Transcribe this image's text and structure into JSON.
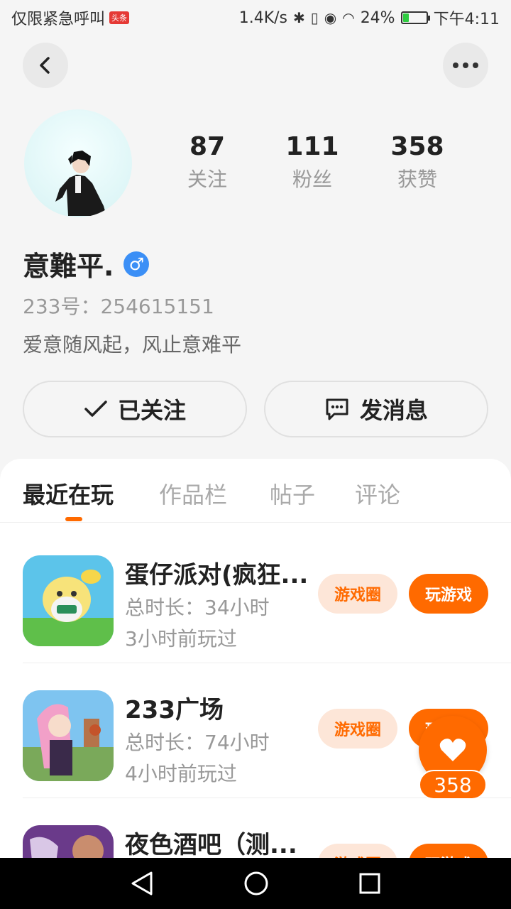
{
  "status_bar": {
    "left_text": "仅限紧急呼叫",
    "badge": "头条",
    "speed": "1.4K/s",
    "battery_percent": "24%",
    "battery_level": 0.24,
    "time": "下午4:11"
  },
  "profile": {
    "stats": [
      {
        "value": "87",
        "label": "关注"
      },
      {
        "value": "111",
        "label": "粉丝"
      },
      {
        "value": "358",
        "label": "获赞"
      }
    ],
    "name": "意難平.",
    "gender_symbol": "♂",
    "uid": "233号：254615151",
    "bio": "爱意随风起，风止意难平",
    "follow_label": "已关注",
    "message_label": "发消息"
  },
  "tabs": [
    {
      "label": "最近在玩",
      "active": true
    },
    {
      "label": "作品栏",
      "active": false
    },
    {
      "label": "帖子",
      "active": false
    },
    {
      "label": "评论",
      "active": false
    }
  ],
  "games": [
    {
      "title": "蛋仔派对(疯狂...",
      "duration": "总时长：34小时",
      "last_played": "3小时前玩过",
      "circle_label": "游戏圈",
      "play_label": "玩游戏"
    },
    {
      "title": "233广场",
      "duration": "总时长：74小时",
      "last_played": "4小时前玩过",
      "circle_label": "游戏圈",
      "play_label": "玩游戏"
    },
    {
      "title": "夜色酒吧（测...",
      "duration": "",
      "last_played": "",
      "circle_label": "游戏圈",
      "play_label": "玩游戏"
    }
  ],
  "like_fab": {
    "count": "358"
  },
  "colors": {
    "accent": "#ff6a00",
    "accent_light": "#fde6d8",
    "gender": "#3b8ff6"
  }
}
